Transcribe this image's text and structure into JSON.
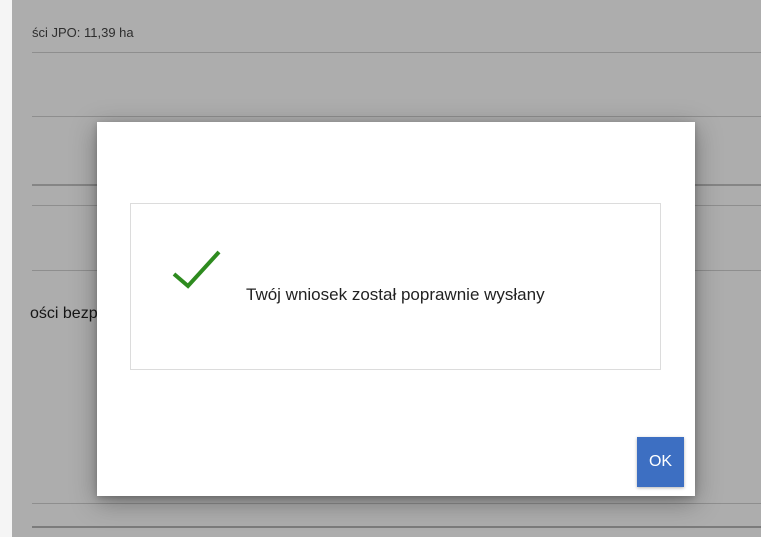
{
  "background": {
    "area_info": "ści JPO: 11,39 ha",
    "security_text": "ości bezp"
  },
  "dialog": {
    "icon": "check-icon",
    "icon_color": "#2e8b1f",
    "message": "Twój wniosek został poprawnie wysłany",
    "ok_label": "OK",
    "ok_color": "#3d6fc2"
  }
}
